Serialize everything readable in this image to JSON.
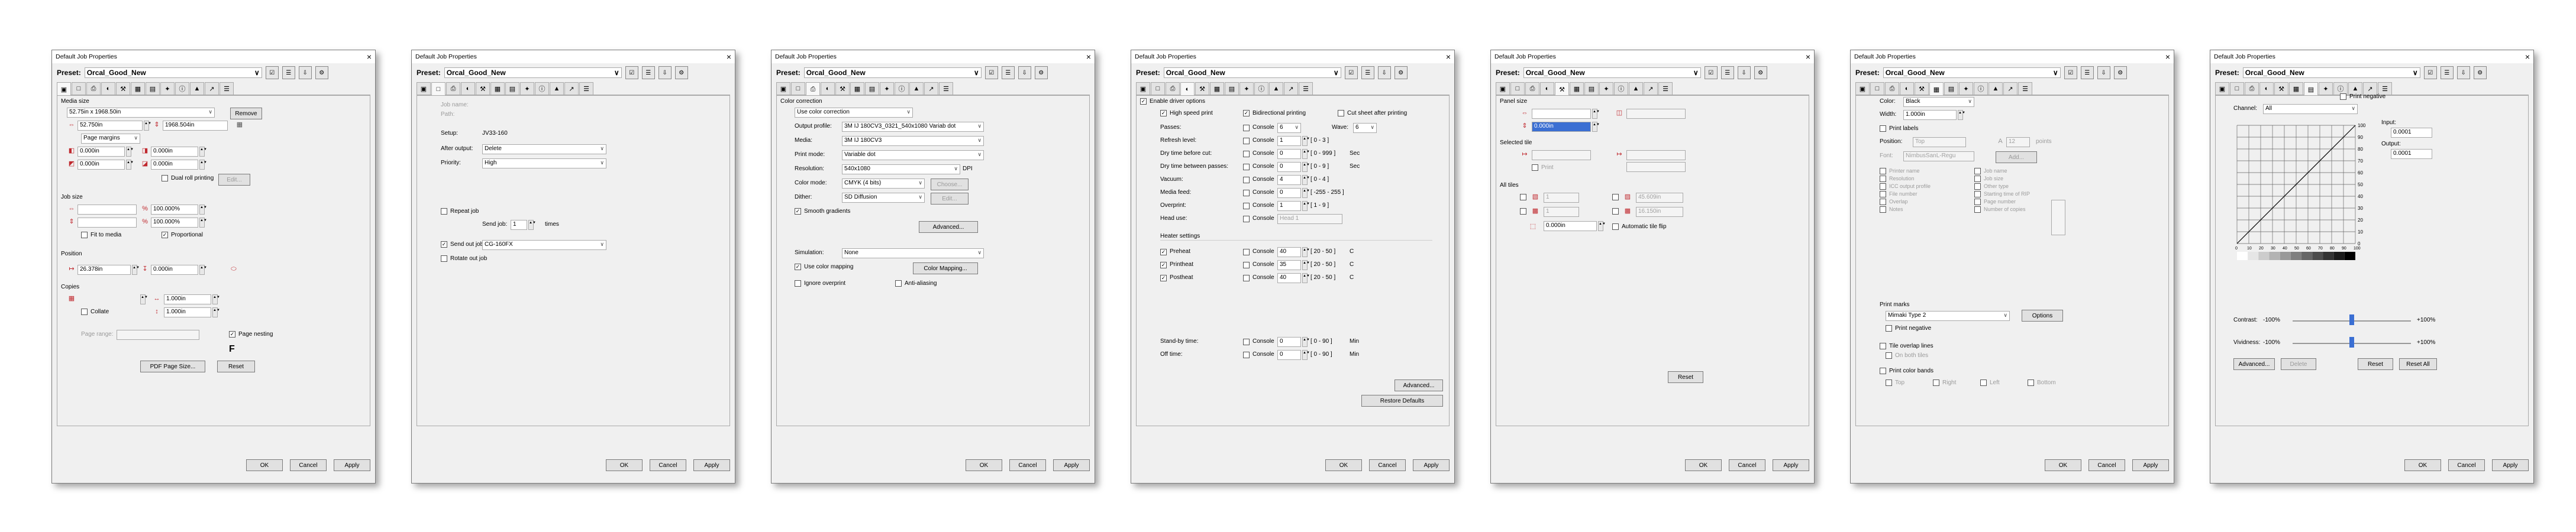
{
  "common": {
    "window_title": "Default Job Properties",
    "preset_label": "Preset:",
    "preset_value": "Orcal_Good_New",
    "ok": "OK",
    "cancel": "Cancel",
    "apply": "Apply",
    "close_glyph": "×",
    "tabs": [
      "page",
      "layout",
      "print",
      "color",
      "setup",
      "calib",
      "tile",
      "marks",
      "info",
      "ink",
      "curve",
      "extra"
    ]
  },
  "d1": {
    "media_size": "Media size",
    "media_combo": "52.75in x 1968.50in",
    "remove": "Remove",
    "w": "52.750in",
    "h": "1968.504in",
    "page_margins": "Page margins",
    "m1": "0.000in",
    "m2": "0.000in",
    "m3": "0.000in",
    "m4": "0.000in",
    "dual_roll": "Dual roll printing",
    "edit": "Edit...",
    "job_size": "Job size",
    "s1": "100.000%",
    "s2": "100.000%",
    "fit": "Fit to media",
    "prop": "Proportional",
    "position": "Position",
    "px": "26.378in",
    "py": "0.000in",
    "copies": "Copies",
    "c1": "1.000in",
    "c2": "1.000in",
    "collate": "Collate",
    "page_range": "Page range:",
    "page_nesting": "Page nesting",
    "f": "F",
    "pdf": "PDF Page Size...",
    "reset": "Reset"
  },
  "d2": {
    "job_name": "Job name:",
    "path": "Path:",
    "setup": "Setup:",
    "setup_val": "JV33-160",
    "after": "After output:",
    "after_val": "Delete",
    "priority": "Priority:",
    "priority_val": "High",
    "repeat": "Repeat job",
    "send_job": "Send job:",
    "send_n": "1",
    "times": "times",
    "send_out": "Send out job",
    "send_out_val": "CG-160FX",
    "rotate": "Rotate out job"
  },
  "d3": {
    "color_correction": "Color correction",
    "use_cc": "Use color correction",
    "out_profile": "Output profile:",
    "out_profile_val": "3M IJ 180CV3_0321_540x1080 Variab dot",
    "media": "Media:",
    "media_val": "3M IJ 180CV3",
    "print_mode": "Print mode:",
    "print_mode_val": "Variable dot",
    "res": "Resolution:",
    "res_val": "540x1080",
    "dpi": "DPI",
    "color_mode": "Color mode:",
    "color_mode_val": "CMYK (4 bits)",
    "choose": "Choose...",
    "dither": "Dither:",
    "dither_val": "SD Diffusion",
    "dedit": "Edit...",
    "smooth": "Smooth gradients",
    "adv": "Advanced...",
    "sim": "Simulation:",
    "sim_val": "None",
    "use_cm": "Use color mapping",
    "cm_btn": "Color Mapping...",
    "ignore": "Ignore overprint",
    "anti": "Anti-aliasing"
  },
  "d4": {
    "enable": "Enable driver options",
    "hs": "High speed print",
    "bidi": "Bidirectional printing",
    "cut": "Cut sheet after printing",
    "passes": "Passes:",
    "passes_val": "6",
    "wave": "Wave:",
    "wave_val": "6",
    "refresh": "Refresh level:",
    "refresh_val": "1",
    "r03": "[ 0 - 3 ]",
    "drybefore": "Dry time before cut:",
    "drybefore_val": "0",
    "r0999": "[ 0 - 999 ]",
    "sec": "Sec",
    "drybetween": "Dry time between passes:",
    "drybetween_val": "0",
    "r09": "[ 0 - 9 ]",
    "vacuum": "Vacuum:",
    "vacuum_val": "4",
    "r04": "[ 0 - 4 ]",
    "mediafeed": "Media feed:",
    "mediafeed_val": "0",
    "r255": "[ -255 - 255 ]",
    "overprint": "Overprint:",
    "overprint_val": "1",
    "r19": "[ 1 - 9 ]",
    "headuse": "Head use:",
    "headuse_val": "Head 1",
    "console": "Console",
    "heater": "Heater settings",
    "preheat": "Preheat",
    "printheat": "Printheat",
    "postheat": "Postheat",
    "pre_v": "40",
    "print_v": "35",
    "post_v": "40",
    "r2050": "[ 20 - 50 ]",
    "c": "C",
    "standby": "Stand-by time:",
    "standby_v": "0",
    "offtime": "Off time:",
    "off_v": "0",
    "r090": "[ 0 - 90 ]",
    "min": "Min",
    "advanced": "Advanced...",
    "restore": "Restore Defaults"
  },
  "d5": {
    "panel_size": "Panel size",
    "ps_val": "0.000in",
    "selected_tile": "Selected tile",
    "print": "Print",
    "all_tiles": "All tiles",
    "o1": "1",
    "o2": "1",
    "o3": "45.609in",
    "o4": "16.150in",
    "ov": "0.000in",
    "auto_flip": "Automatic tile flip",
    "reset": "Reset"
  },
  "d6": {
    "color": "Color:",
    "color_val": "Black",
    "width": "Width:",
    "width_val": "1.000in",
    "print_labels": "Print labels",
    "position": "Position:",
    "position_val": "Top",
    "size": "12",
    "points": "points",
    "font": "Font:",
    "font_val": "NimbusSanL-Regu",
    "add": "Add...",
    "lab": [
      "Printer name",
      "Resolution",
      "ICC output profile",
      "File number",
      "Overlap",
      "Notes"
    ],
    "lab2": [
      "Job name",
      "Job size",
      "Other type",
      "Starting time of RIP",
      "Page number",
      "Number of copies"
    ],
    "marks": "Print marks",
    "marks_val": "Mimaki Type 2",
    "options": "Options",
    "neg": "Print negative",
    "tile_overlap": "Tile overlap lines",
    "on_both": "On both tiles",
    "bands": "Print color bands",
    "top": "Top",
    "right": "Right",
    "left": "Left",
    "bottom": "Bottom"
  },
  "d7": {
    "print_neg": "Print negative",
    "channel": "Channel:",
    "channel_val": "All",
    "input": "Input:",
    "input_val": "0.0001",
    "output": "Output:",
    "output_val": "0.0001",
    "contrast": "Contrast:",
    "contrast_min": "-100%",
    "contrast_max": "+100%",
    "vivid": "Vividness:",
    "vivid_min": "-100%",
    "vivid_max": "+100%",
    "advanced": "Advanced...",
    "delete": "Delete",
    "reset": "Reset",
    "reset_all": "Reset All",
    "ticks_y": [
      "100",
      "90",
      "80",
      "70",
      "60",
      "50",
      "40",
      "30",
      "20",
      "10",
      "0"
    ],
    "ticks_x": [
      "0",
      "10",
      "20",
      "30",
      "40",
      "50",
      "60",
      "70",
      "80",
      "90",
      "100"
    ]
  }
}
